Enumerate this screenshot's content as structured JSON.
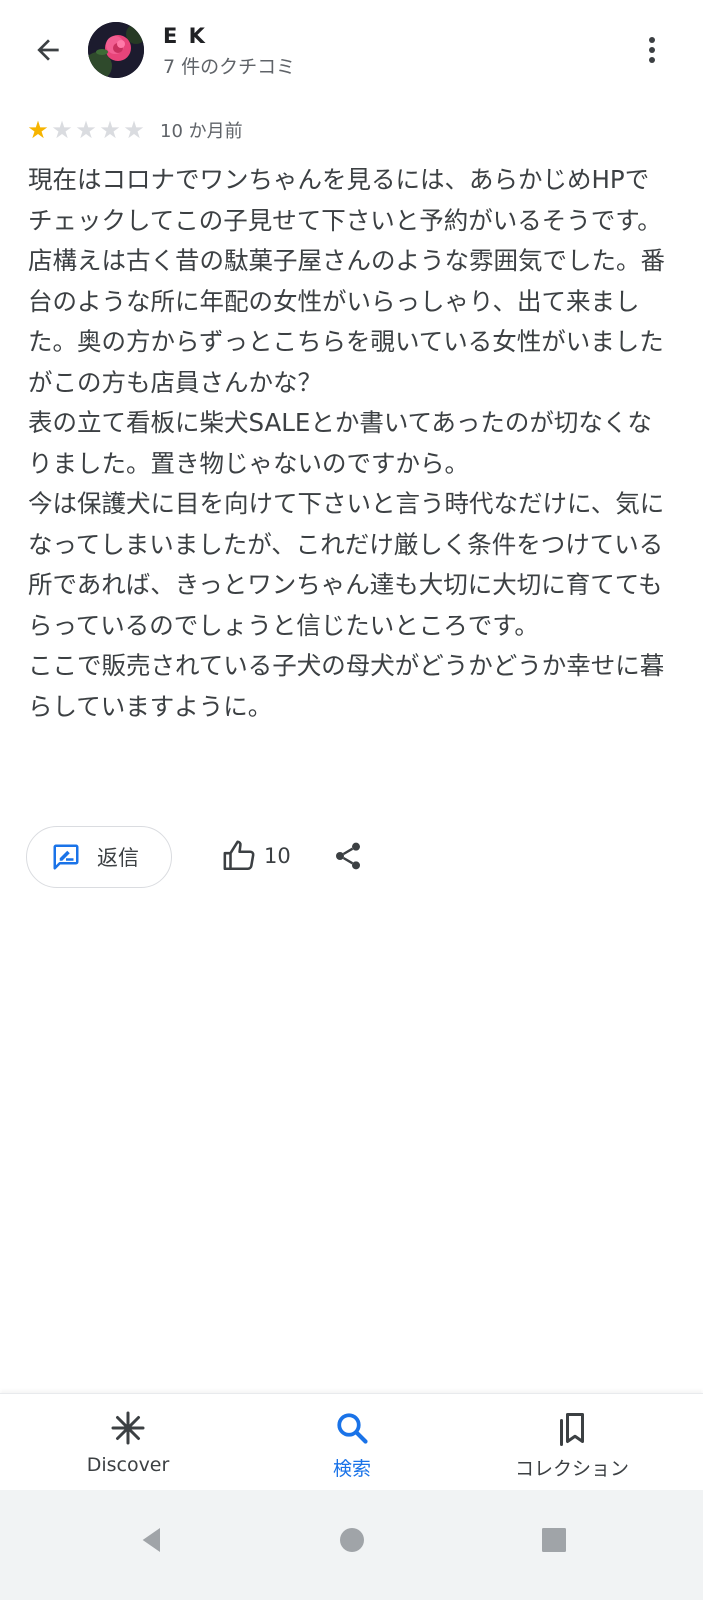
{
  "header": {
    "author_name": "E K",
    "review_count": "7 件のクチコミ"
  },
  "review": {
    "rating": 1,
    "max_rating": 5,
    "time": "10 か月前",
    "text": "現在はコロナでワンちゃんを見るには、あらかじめHPでチェックしてこの子見せて下さいと予約がいるそうです。\n店構えは古く昔の駄菓子屋さんのような雰囲気でした。番台のような所に年配の女性がいらっしゃり、出て来ました。奥の方からずっとこちらを覗いている女性がいましたがこの方も店員さんかな？\n表の立て看板に柴犬SALEとか書いてあったのが切なくなりました。置き物じゃないのですから。\n今は保護犬に目を向けて下さいと言う時代なだけに、気になってしまいましたが、これだけ厳しく条件をつけている所であれば、きっとワンちゃん達も大切に大切に育ててもらっているのでしょうと信じたいところです。\nここで販売されている子犬の母犬がどうかどうか幸せに暮らしていますように。"
  },
  "actions": {
    "reply_label": "返信",
    "like_count": "10"
  },
  "bottom_nav": {
    "items": [
      {
        "label": "Discover",
        "icon": "asterisk-icon",
        "active": false
      },
      {
        "label": "検索",
        "icon": "search-icon",
        "active": true
      },
      {
        "label": "コレクション",
        "icon": "bookmarks-icon",
        "active": false
      }
    ]
  },
  "colors": {
    "accent": "#1a73e8",
    "star": "#f6b400",
    "text": "#3c4043"
  }
}
